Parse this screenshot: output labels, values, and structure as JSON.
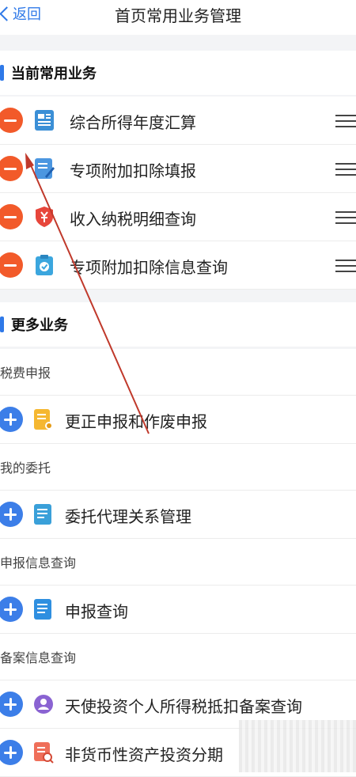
{
  "header": {
    "back_label": "返回",
    "title": "首页常用业务管理"
  },
  "current": {
    "title": "当前常用业务",
    "items": [
      {
        "label": "综合所得年度汇算",
        "icon": "report-grid-icon"
      },
      {
        "label": "专项附加扣除填报",
        "icon": "edit-document-icon"
      },
      {
        "label": "收入纳税明细查询",
        "icon": "yuan-shield-icon"
      },
      {
        "label": "专项附加扣除信息查询",
        "icon": "clipboard-check-icon"
      }
    ]
  },
  "more": {
    "title": "更多业务",
    "categories": [
      {
        "name": "税费申报",
        "items": [
          {
            "label": "更正申报和作废申报",
            "icon": "correction-document-icon"
          }
        ]
      },
      {
        "name": "我的委托",
        "items": [
          {
            "label": "委托代理关系管理",
            "icon": "agency-document-icon"
          }
        ]
      },
      {
        "name": "申报信息查询",
        "items": [
          {
            "label": "申报查询",
            "icon": "declaration-document-icon"
          }
        ]
      },
      {
        "name": "备案信息查询",
        "items": [
          {
            "label": "天使投资个人所得税抵扣备案查询",
            "icon": "angel-person-icon"
          },
          {
            "label": "非货币性资产投资分期",
            "icon": "asset-search-icon"
          }
        ]
      }
    ]
  },
  "colors": {
    "accent": "#2f79e8",
    "minus": "#f25a2a",
    "plus": "#3c7ee8",
    "annotation_arrow": "#c0392b"
  }
}
